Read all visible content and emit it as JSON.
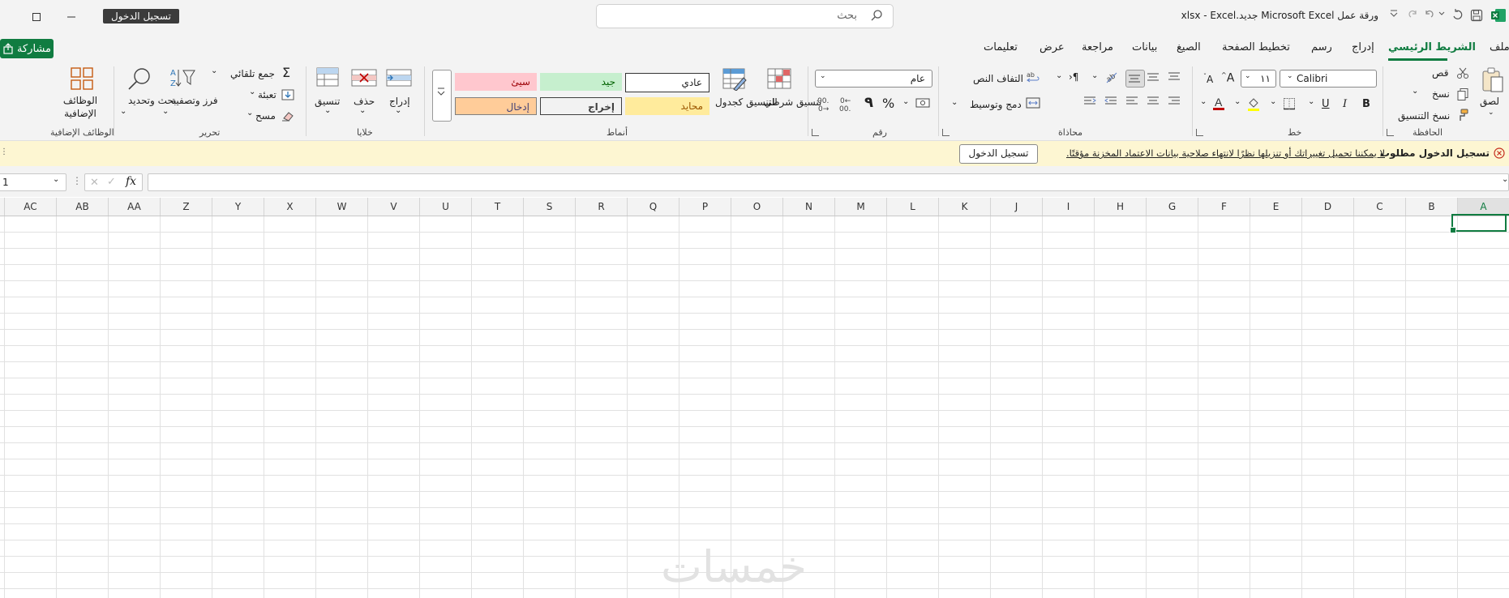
{
  "titlebar": {
    "signin_label": "تسجيل الدخول",
    "search_placeholder": "بحث",
    "doc_title": "ورقة عمل Microsoft Excel جديد.xlsx  -  Excel"
  },
  "tabs": [
    {
      "label": "ملف"
    },
    {
      "label": "الشريط الرئيسي"
    },
    {
      "label": "إدراج"
    },
    {
      "label": "رسم"
    },
    {
      "label": "تخطيط الصفحة"
    },
    {
      "label": "الصيغ"
    },
    {
      "label": "بيانات"
    },
    {
      "label": "مراجعة"
    },
    {
      "label": "عرض"
    },
    {
      "label": "تعليمات"
    }
  ],
  "share_label": "مشاركة",
  "ribbon": {
    "clipboard": {
      "group": "الحافظة",
      "paste": "لصق",
      "cut": "قص",
      "copy": "نسخ",
      "format_painter": "نسخ التنسيق"
    },
    "font": {
      "group": "خط",
      "font_name": "Calibri",
      "font_size": "١١",
      "bold": "B",
      "italic": "I",
      "underline": "U"
    },
    "alignment": {
      "group": "محاذاة",
      "wrap_text": "التفاف النص",
      "merge_center": "دمج وتوسيط"
    },
    "number": {
      "group": "رقم",
      "format": "عام"
    },
    "styles": {
      "group": "أنماط",
      "conditional": "تنسيق شرطي",
      "as_table": "التنسيق كجدول",
      "cells": [
        {
          "label": "عادي",
          "bg": "#ffffff"
        },
        {
          "label": "جيد",
          "bg": "#c6efce"
        },
        {
          "label": "سيئ",
          "bg": "#ffc7ce"
        },
        {
          "label": "محايد",
          "bg": "#ffeb9c"
        },
        {
          "label": "إخراج",
          "bg": "#f2f2f2"
        },
        {
          "label": "إدخال",
          "bg": "#ffcc99"
        }
      ]
    },
    "cells": {
      "group": "خلايا",
      "insert": "إدراج",
      "delete": "حذف",
      "format": "تنسيق"
    },
    "editing": {
      "group": "تحرير",
      "autosum": "جمع تلقائي",
      "fill": "تعبئة",
      "clear": "مسح",
      "sort_filter": "فرز وتصفية",
      "find_select": "بحث وتحديد"
    },
    "addins": {
      "group": "الوظائف الإضافية",
      "label": "الوظائف الإضافية"
    }
  },
  "message_bar": {
    "title": "تسجيل الدخول مطلوب",
    "text": "لا يمكننا تحميل تغييراتك أو تنزيلها نظرًا لانتهاء صلاحية بيانات الاعتماد المخزنة مؤقتًا.",
    "button": "تسجيل الدخول"
  },
  "formula_bar": {
    "namebox": "1",
    "fx": "fx",
    "value": ""
  },
  "columns": [
    "A",
    "B",
    "C",
    "D",
    "E",
    "F",
    "G",
    "H",
    "I",
    "J",
    "K",
    "L",
    "M",
    "N",
    "O",
    "P",
    "Q",
    "R",
    "S",
    "T",
    "U",
    "V",
    "W",
    "X",
    "Y",
    "Z",
    "AA",
    "AB",
    "AC"
  ],
  "selected_column": "A",
  "watermark": "خمسات",
  "colors": {
    "accent": "#107c41"
  }
}
